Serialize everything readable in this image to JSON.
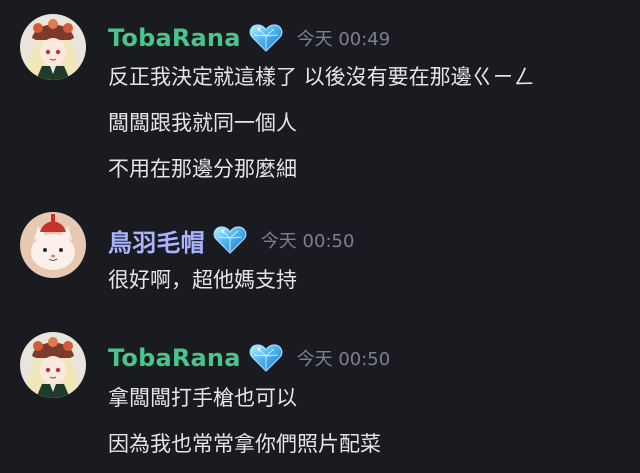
{
  "theme": {
    "background": "#1a1b21",
    "username_colors": {
      "tobarana": "#4bc48a",
      "toriba": "#a9b4ff"
    },
    "timestamp_color": "#7d808b",
    "text_color": "#e4e5e9"
  },
  "messages": [
    {
      "username": "TobaRana",
      "badge_icon": "blue-heart-crystal-icon",
      "timestamp": "今天 00:49",
      "avatar_icon": "anime-girl-avatar-icon",
      "lines": [
        "反正我決定就這樣了 以後沒有要在那邊ㄍㄧㄥ",
        "闆闆跟我就同一個人",
        "不用在那邊分那麼細"
      ]
    },
    {
      "username": "鳥羽毛帽",
      "badge_icon": "blue-heart-crystal-icon",
      "timestamp": "今天 00:50",
      "avatar_icon": "cat-avatar-icon",
      "lines": [
        "很好啊，超他媽支持"
      ]
    },
    {
      "username": "TobaRana",
      "badge_icon": "blue-heart-crystal-icon",
      "timestamp": "今天 00:50",
      "avatar_icon": "anime-girl-avatar-icon",
      "lines": [
        "拿闆闆打手槍也可以",
        "因為我也常常拿你們照片配菜"
      ]
    }
  ]
}
